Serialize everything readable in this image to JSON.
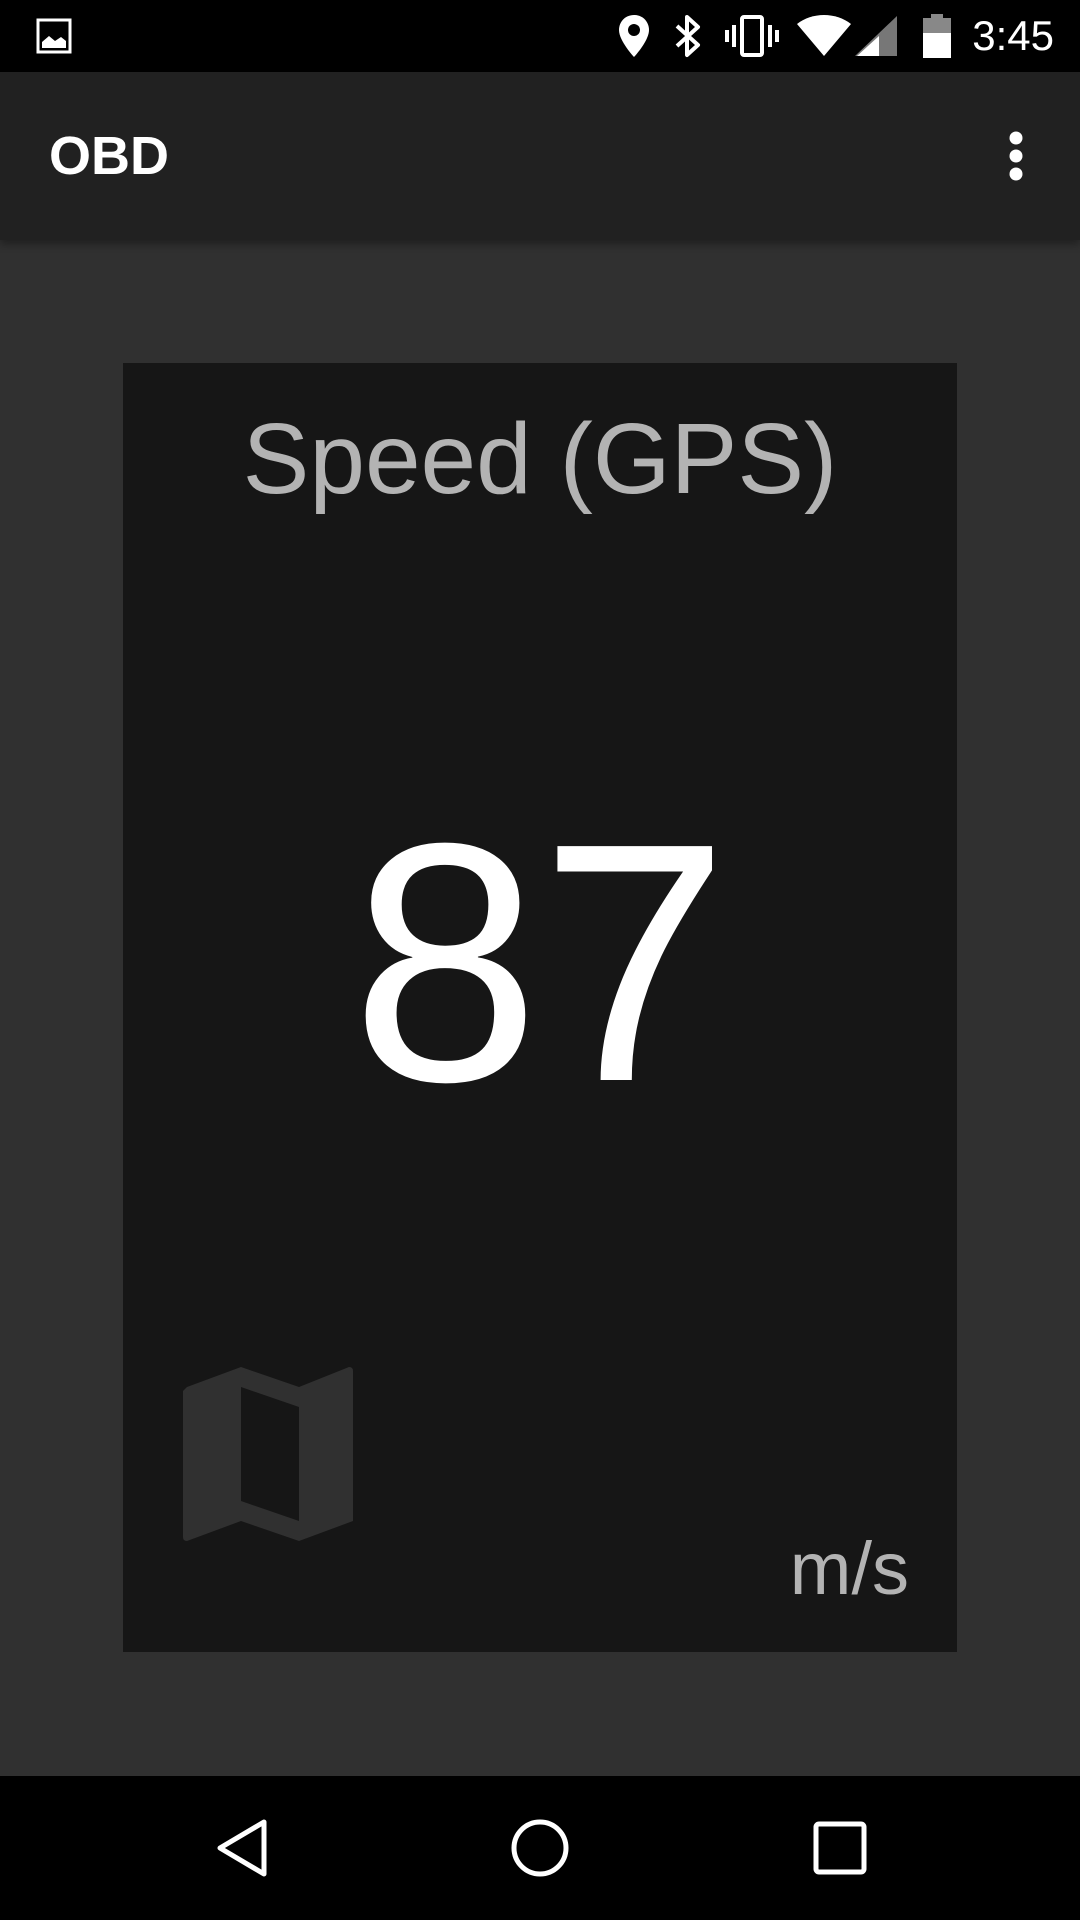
{
  "status_bar": {
    "time": "3:45",
    "icons": [
      "image-notification-icon",
      "location-icon",
      "bluetooth-icon",
      "vibrate-icon",
      "wifi-icon",
      "cellular-signal-icon",
      "battery-icon"
    ]
  },
  "app_bar": {
    "title": "OBD",
    "menu_icon": "more-vert-icon"
  },
  "card": {
    "title": "Speed (GPS)",
    "value": "87",
    "unit": "m/s",
    "icon": "map-icon"
  },
  "nav_bar": {
    "buttons": [
      "back-icon",
      "home-icon",
      "recents-icon"
    ]
  },
  "colors": {
    "status_bar_bg": "#000000",
    "app_bar_bg": "#212121",
    "content_bg": "#303030",
    "card_bg": "#161616",
    "primary_text": "#ffffff",
    "secondary_text": "#b3b3b3"
  }
}
